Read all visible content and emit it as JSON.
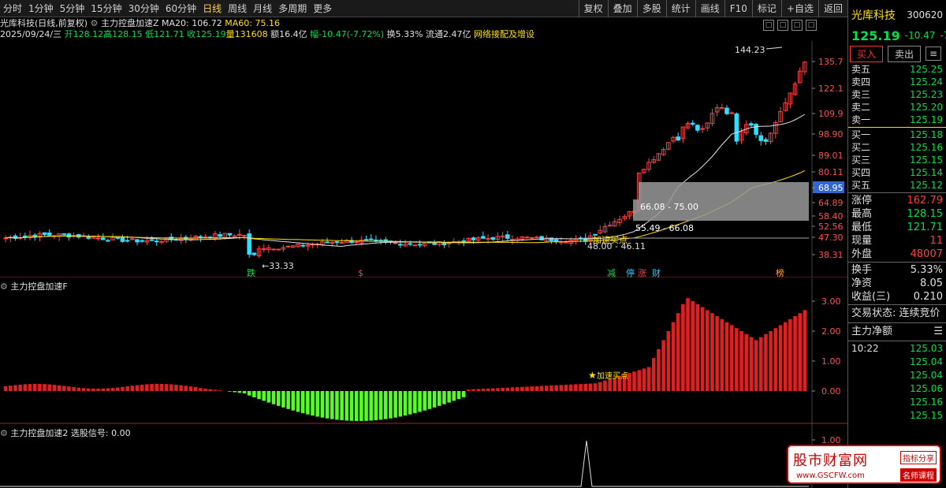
{
  "toolbar": {
    "periods": [
      "分时",
      "1分钟",
      "5分钟",
      "15分钟",
      "30分钟",
      "60分钟",
      "日线",
      "周线",
      "月线",
      "多周期",
      "更多"
    ],
    "active_period": "日线",
    "right_buttons": [
      "复权",
      "叠加",
      "多股",
      "统计",
      "画线",
      "F10",
      "标记",
      "+自选",
      "返回"
    ]
  },
  "info": {
    "title": "光库科技(日线,前复权)",
    "indicator_name": "主力控盘加速Z",
    "ma20": "MA20: 106.72",
    "ma60": "MA60: 75.16",
    "date": "2025/09/24/三",
    "open": "开128.12",
    "high": "高128.15",
    "low": "低121.71",
    "close": "收125.19",
    "volume": "量131608",
    "amount": "额16.4亿",
    "change": "幅-10.47(-7.72%)",
    "turnover": "换5.33%",
    "float": "流通2.47亿",
    "note": "网络接配及增设"
  },
  "main_chart": {
    "y_ticks": [
      "135.7",
      "122.1",
      "109.9",
      "98.90",
      "89.01",
      "80.11",
      "68.95",
      "64.89",
      "58.40",
      "52.56",
      "47.30",
      "38.31"
    ],
    "highlighted_tick": "68.95",
    "annotations": {
      "high_label": "144.23",
      "low_label": "33.33",
      "zone1": "66.08 - 75.00",
      "zone2": "55.49 - 66.08",
      "zone3": "48.00 - 46.11",
      "accel": "加速买点"
    },
    "markers": [
      "跌",
      "$",
      "减",
      "停",
      "涨",
      "财",
      "榜"
    ]
  },
  "indicator_panel": {
    "title": "主力控盘加速F",
    "y_ticks": [
      "3.00",
      "2.00",
      "1.00",
      "0.00"
    ],
    "label": "加速买点"
  },
  "signal_panel": {
    "title": "主力控盘加速2",
    "signal": "选股信号: 0.00",
    "y_ticks": [
      "1.00"
    ]
  },
  "quote": {
    "name": "光库科技",
    "code": "300620",
    "price": "125.19",
    "change": "-10.47",
    "change_pct": "-7",
    "buy_label": "买入",
    "sell_label": "卖出",
    "more_label": "¥",
    "asks": [
      {
        "label": "卖五",
        "price": "125.25"
      },
      {
        "label": "卖四",
        "price": "125.24"
      },
      {
        "label": "卖三",
        "price": "125.23"
      },
      {
        "label": "卖二",
        "price": "125.20"
      },
      {
        "label": "卖一",
        "price": "125.19"
      }
    ],
    "bids": [
      {
        "label": "买一",
        "price": "125.18"
      },
      {
        "label": "买二",
        "price": "125.16"
      },
      {
        "label": "买三",
        "price": "125.15"
      },
      {
        "label": "买四",
        "price": "125.14"
      },
      {
        "label": "买五",
        "price": "125.12"
      }
    ],
    "stats": [
      {
        "label": "涨停",
        "value": "162.79",
        "cls": "red"
      },
      {
        "label": "最高",
        "value": "128.15",
        "cls": ""
      },
      {
        "label": "最低",
        "value": "121.71",
        "cls": ""
      },
      {
        "label": "现量",
        "value": "11",
        "cls": "red"
      },
      {
        "label": "外盘",
        "value": "48007",
        "cls": "red"
      }
    ],
    "stats2": [
      {
        "label": "换手",
        "value": "5.33%",
        "cls": "white"
      },
      {
        "label": "净资",
        "value": "8.05",
        "cls": "white"
      },
      {
        "label": "收益(三)",
        "value": "0.210",
        "cls": "white"
      }
    ],
    "status": "交易状态: 连续竞价",
    "netflow": "主力净额",
    "ticks": [
      {
        "t": "10:22",
        "v": "125.03"
      },
      {
        "t": "",
        "v": "125.04"
      },
      {
        "t": "",
        "v": "125.04"
      },
      {
        "t": "",
        "v": "125.06"
      },
      {
        "t": "",
        "v": "125.16"
      },
      {
        "t": "",
        "v": "125.15"
      }
    ]
  },
  "watermark": {
    "title": "股市财富网",
    "url": "www.GSCFW.com",
    "badge1": "指标分享",
    "badge2": "名师课程"
  },
  "colors": {
    "up": "#ff4040",
    "down": "#00e050",
    "ma20": "#e0e0e0",
    "ma60": "#ffe000",
    "zone": "#999999"
  }
}
